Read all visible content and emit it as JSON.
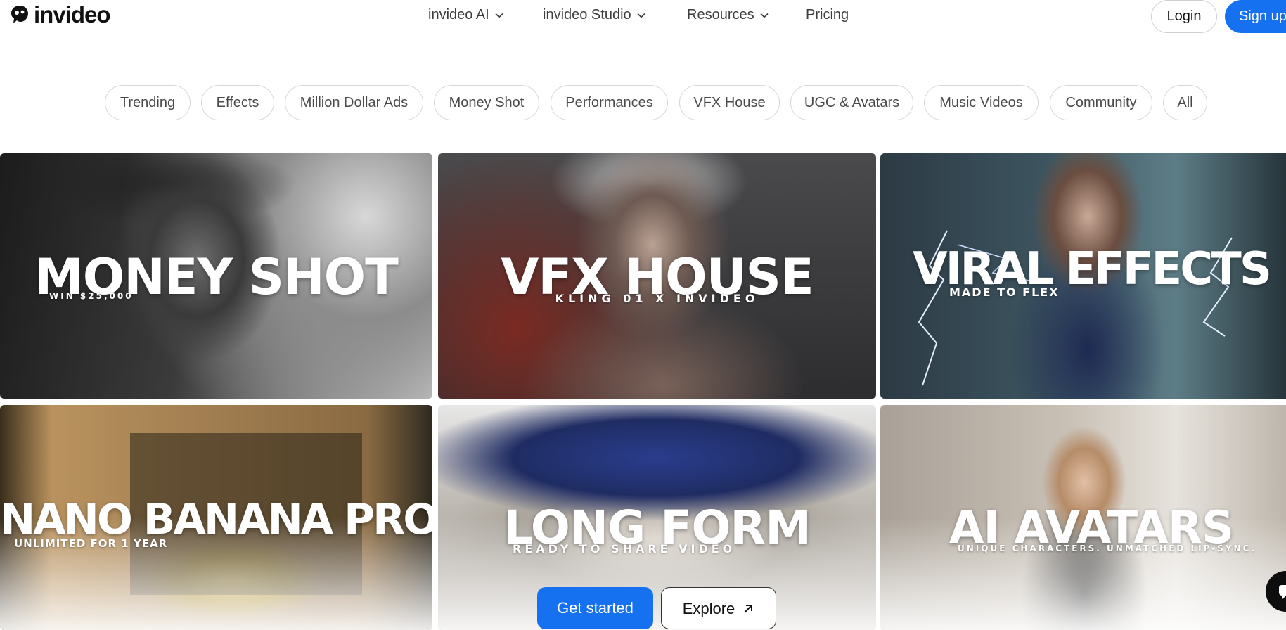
{
  "brand": {
    "name": "invideo",
    "logo_icon": "invideo-logo-icon"
  },
  "nav": {
    "items": [
      {
        "label": "invideo AI",
        "icon": "chevron-down-icon"
      },
      {
        "label": "invideo Studio",
        "icon": "chevron-down-icon"
      },
      {
        "label": "Resources",
        "icon": "chevron-down-icon"
      },
      {
        "label": "Pricing"
      }
    ],
    "login_label": "Login",
    "signup_label": "Sign up"
  },
  "chips": [
    "Trending",
    "Effects",
    "Million Dollar Ads",
    "Money Shot",
    "Performances",
    "VFX House",
    "UGC & Avatars",
    "Music Videos",
    "Community",
    "All"
  ],
  "cards": [
    {
      "title": "MONEY SHOT",
      "subtitle": "WIN $25,000"
    },
    {
      "title": "VFX HOUSE",
      "subtitle": "KLING 01 X INVIDEO"
    },
    {
      "title": "VIRAL EFFECTS",
      "subtitle": "MADE TO FLEX"
    },
    {
      "title": "NANO BANANA PRO",
      "subtitle": "UNLIMITED FOR 1 YEAR"
    },
    {
      "title": "LONG FORM",
      "subtitle": "READY TO SHARE VIDEO"
    },
    {
      "title": "AI AVATARS",
      "subtitle": "UNIQUE CHARACTERS. UNMATCHED LIP-SYNC."
    }
  ],
  "cta": {
    "primary_label": "Get started",
    "secondary_label": "Explore",
    "secondary_icon": "arrow-up-right-icon"
  },
  "chat": {
    "icon": "chat-icon"
  },
  "colors": {
    "accent": "#1671f0",
    "text": "#1a1a1a",
    "border": "#d6d6d6"
  }
}
